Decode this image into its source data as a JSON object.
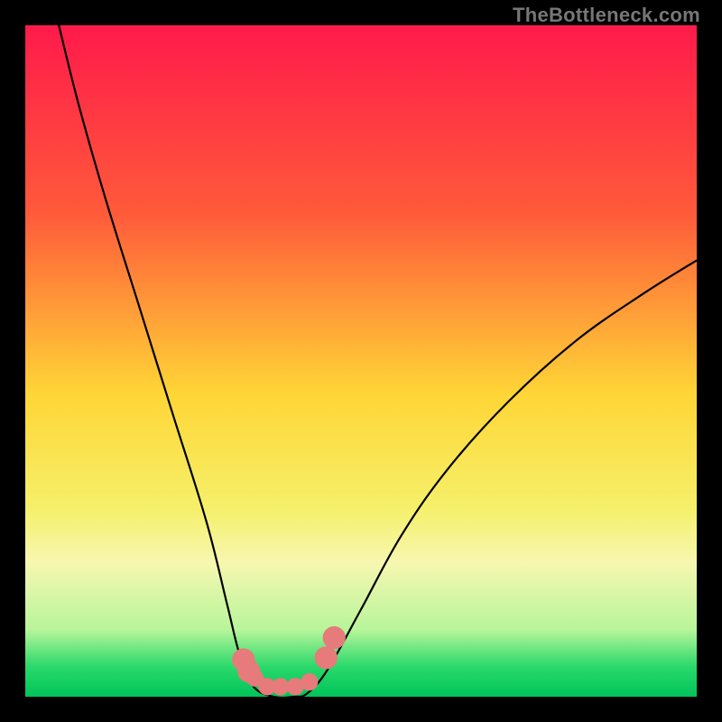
{
  "attribution": "TheBottleneck.com",
  "chart_data": {
    "type": "line",
    "title": "",
    "xlabel": "",
    "ylabel": "",
    "xlim": [
      0,
      100
    ],
    "ylim": [
      0,
      100
    ],
    "gradient_stops": [
      {
        "offset": 0,
        "color": "#ff1a4b"
      },
      {
        "offset": 0.28,
        "color": "#ff5a3a"
      },
      {
        "offset": 0.55,
        "color": "#ffd636"
      },
      {
        "offset": 0.72,
        "color": "#f5f06a"
      },
      {
        "offset": 0.8,
        "color": "#f7f7b0"
      },
      {
        "offset": 0.9,
        "color": "#b8f59a"
      },
      {
        "offset": 0.955,
        "color": "#2bd96b"
      },
      {
        "offset": 1.0,
        "color": "#00c45a"
      }
    ],
    "curve_1": [
      {
        "x": 5,
        "y": 100
      },
      {
        "x": 8,
        "y": 88
      },
      {
        "x": 12,
        "y": 74
      },
      {
        "x": 17,
        "y": 58
      },
      {
        "x": 22,
        "y": 42
      },
      {
        "x": 27,
        "y": 26
      },
      {
        "x": 30,
        "y": 14
      },
      {
        "x": 32,
        "y": 6
      },
      {
        "x": 34,
        "y": 1.5
      },
      {
        "x": 37,
        "y": 0
      },
      {
        "x": 40,
        "y": 0
      },
      {
        "x": 42,
        "y": 0.5
      },
      {
        "x": 45,
        "y": 4
      },
      {
        "x": 50,
        "y": 13
      },
      {
        "x": 56,
        "y": 24
      },
      {
        "x": 63,
        "y": 34
      },
      {
        "x": 72,
        "y": 44
      },
      {
        "x": 82,
        "y": 53
      },
      {
        "x": 92,
        "y": 60
      },
      {
        "x": 100,
        "y": 65
      }
    ],
    "dots": [
      {
        "x": 32.5,
        "y": 5.5
      },
      {
        "x": 33.3,
        "y": 3.8
      },
      {
        "x": 34.2,
        "y": 2.8
      },
      {
        "x": 36.0,
        "y": 1.5
      },
      {
        "x": 38.0,
        "y": 1.5
      },
      {
        "x": 40.2,
        "y": 1.5
      },
      {
        "x": 42.3,
        "y": 2.2
      },
      {
        "x": 44.8,
        "y": 5.8
      },
      {
        "x": 46.0,
        "y": 8.8
      }
    ],
    "dot_color": "#e77a7a",
    "dot_radius_primary": 1.7,
    "dot_radius_secondary": 1.3,
    "curve_color": "#000000",
    "curve_width": 0.35
  }
}
